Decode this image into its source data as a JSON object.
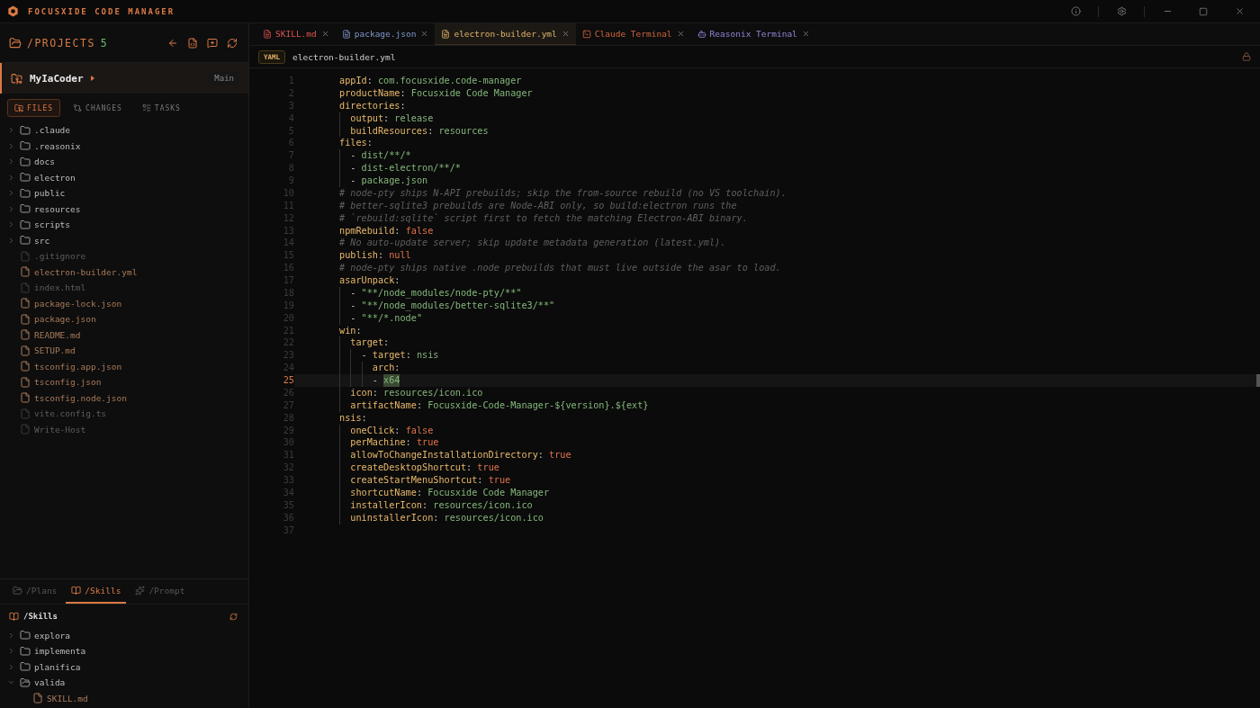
{
  "window": {
    "title": "FOCUSXIDE CODE MANAGER"
  },
  "projects": {
    "label": "/PROJECTS",
    "count": "5"
  },
  "project": {
    "name": "MyIaCoder",
    "branch": "Main",
    "selected": true
  },
  "view_tabs": [
    {
      "label": "FILES",
      "kind": "files",
      "selected": true
    },
    {
      "label": "CHANGES",
      "kind": "changes",
      "selected": false
    },
    {
      "label": "TASKS",
      "kind": "tasks",
      "selected": false
    }
  ],
  "file_tree": [
    {
      "kind": "folder",
      "name": ".claude",
      "expanded": false,
      "dimmed": false
    },
    {
      "kind": "folder",
      "name": ".reasonix",
      "expanded": false,
      "dimmed": false
    },
    {
      "kind": "folder",
      "name": "docs",
      "expanded": false,
      "dimmed": false
    },
    {
      "kind": "folder",
      "name": "electron",
      "expanded": false,
      "dimmed": false
    },
    {
      "kind": "folder",
      "name": "public",
      "expanded": false,
      "dimmed": false
    },
    {
      "kind": "folder",
      "name": "resources",
      "expanded": false,
      "dimmed": false
    },
    {
      "kind": "folder",
      "name": "scripts",
      "expanded": false,
      "dimmed": false
    },
    {
      "kind": "folder",
      "name": "src",
      "expanded": false,
      "dimmed": false
    },
    {
      "kind": "file",
      "name": ".gitignore",
      "dimmed": true
    },
    {
      "kind": "file",
      "name": "electron-builder.yml",
      "dimmed": false
    },
    {
      "kind": "file",
      "name": "index.html",
      "dimmed": true
    },
    {
      "kind": "file",
      "name": "package-lock.json",
      "dimmed": false
    },
    {
      "kind": "file",
      "name": "package.json",
      "dimmed": false
    },
    {
      "kind": "file",
      "name": "README.md",
      "dimmed": false
    },
    {
      "kind": "file",
      "name": "SETUP.md",
      "dimmed": false
    },
    {
      "kind": "file",
      "name": "tsconfig.app.json",
      "dimmed": false
    },
    {
      "kind": "file",
      "name": "tsconfig.json",
      "dimmed": false
    },
    {
      "kind": "file",
      "name": "tsconfig.node.json",
      "dimmed": false
    },
    {
      "kind": "file",
      "name": "vite.config.ts",
      "dimmed": true
    },
    {
      "kind": "file",
      "name": "Write-Host",
      "dimmed": true
    }
  ],
  "bottom_tabs": [
    {
      "label": "/Plans",
      "kind": "plans",
      "selected": false
    },
    {
      "label": "/Skills",
      "kind": "skills",
      "selected": true
    },
    {
      "label": "/Prompt",
      "kind": "prompt",
      "selected": false
    }
  ],
  "skills": {
    "title": "/Skills",
    "tree": [
      {
        "kind": "folder",
        "name": "explora",
        "expanded": false
      },
      {
        "kind": "folder",
        "name": "implementa",
        "expanded": false
      },
      {
        "kind": "folder",
        "name": "planifica",
        "expanded": false
      },
      {
        "kind": "folder",
        "name": "valida",
        "expanded": true,
        "children": [
          {
            "kind": "file",
            "name": "SKILL.md"
          }
        ]
      }
    ]
  },
  "editor_tabs": [
    {
      "label": "SKILL.md",
      "kind": "markdown",
      "selected": false
    },
    {
      "label": "package.json",
      "kind": "json",
      "selected": false
    },
    {
      "label": "electron-builder.yml",
      "kind": "yaml",
      "selected": true
    },
    {
      "label": "Claude Terminal",
      "kind": "terminal",
      "selected": false
    },
    {
      "label": "Reasonix Terminal",
      "kind": "agent",
      "selected": false
    }
  ],
  "file_bar": {
    "badge": "YAML",
    "path": "electron-builder.yml",
    "locked": true
  },
  "code": [
    {
      "number": "1",
      "current": false,
      "tokens": [
        {
          "kind": "key",
          "text": "appId"
        },
        {
          "kind": "punct",
          "text": ": "
        },
        {
          "kind": "value",
          "text": "com.focusxide.code-manager"
        }
      ]
    },
    {
      "number": "2",
      "current": false,
      "tokens": [
        {
          "kind": "key",
          "text": "productName"
        },
        {
          "kind": "punct",
          "text": ": "
        },
        {
          "kind": "value",
          "text": "Focusxide Code Manager"
        }
      ]
    },
    {
      "number": "3",
      "current": false,
      "tokens": [
        {
          "kind": "key",
          "text": "directories"
        },
        {
          "kind": "punct",
          "text": ":"
        }
      ]
    },
    {
      "number": "4",
      "current": false,
      "tokens": [
        {
          "kind": "key",
          "text": "  output"
        },
        {
          "kind": "punct",
          "text": ": "
        },
        {
          "kind": "value",
          "text": "release"
        }
      ]
    },
    {
      "number": "5",
      "current": false,
      "tokens": [
        {
          "kind": "key",
          "text": "  buildResources"
        },
        {
          "kind": "punct",
          "text": ": "
        },
        {
          "kind": "value",
          "text": "resources"
        }
      ]
    },
    {
      "number": "6",
      "current": false,
      "tokens": [
        {
          "kind": "key",
          "text": "files"
        },
        {
          "kind": "punct",
          "text": ":"
        }
      ]
    },
    {
      "number": "7",
      "current": false,
      "tokens": [
        {
          "kind": "punct",
          "text": "  - "
        },
        {
          "kind": "value",
          "text": "dist/**/*"
        }
      ]
    },
    {
      "number": "8",
      "current": false,
      "tokens": [
        {
          "kind": "punct",
          "text": "  - "
        },
        {
          "kind": "value",
          "text": "dist-electron/**/*"
        }
      ]
    },
    {
      "number": "9",
      "current": false,
      "tokens": [
        {
          "kind": "punct",
          "text": "  - "
        },
        {
          "kind": "value",
          "text": "package.json"
        }
      ]
    },
    {
      "number": "10",
      "current": false,
      "tokens": [
        {
          "kind": "comment",
          "text": "# node-pty ships N-API prebuilds; skip the from-source rebuild (no VS toolchain)."
        }
      ]
    },
    {
      "number": "11",
      "current": false,
      "tokens": [
        {
          "kind": "comment",
          "text": "# better-sqlite3 prebuilds are Node-ABI only, so build:electron runs the"
        }
      ]
    },
    {
      "number": "12",
      "current": false,
      "tokens": [
        {
          "kind": "comment",
          "text": "# `rebuild:sqlite` script first to fetch the matching Electron-ABI binary."
        }
      ]
    },
    {
      "number": "13",
      "current": false,
      "tokens": [
        {
          "kind": "key",
          "text": "npmRebuild"
        },
        {
          "kind": "punct",
          "text": ": "
        },
        {
          "kind": "bool",
          "text": "false"
        }
      ]
    },
    {
      "number": "14",
      "current": false,
      "tokens": [
        {
          "kind": "comment",
          "text": "# No auto-update server; skip update metadata generation (latest.yml)."
        }
      ]
    },
    {
      "number": "15",
      "current": false,
      "tokens": [
        {
          "kind": "key",
          "text": "publish"
        },
        {
          "kind": "punct",
          "text": ": "
        },
        {
          "kind": "bool",
          "text": "null"
        }
      ]
    },
    {
      "number": "16",
      "current": false,
      "tokens": [
        {
          "kind": "comment",
          "text": "# node-pty ships native .node prebuilds that must live outside the asar to load."
        }
      ]
    },
    {
      "number": "17",
      "current": false,
      "tokens": [
        {
          "kind": "key",
          "text": "asarUnpack"
        },
        {
          "kind": "punct",
          "text": ":"
        }
      ]
    },
    {
      "number": "18",
      "current": false,
      "tokens": [
        {
          "kind": "punct",
          "text": "  - "
        },
        {
          "kind": "value",
          "text": "\"**/node_modules/node-pty/**\""
        }
      ]
    },
    {
      "number": "19",
      "current": false,
      "tokens": [
        {
          "kind": "punct",
          "text": "  - "
        },
        {
          "kind": "value",
          "text": "\"**/node_modules/better-sqlite3/**\""
        }
      ]
    },
    {
      "number": "20",
      "current": false,
      "tokens": [
        {
          "kind": "punct",
          "text": "  - "
        },
        {
          "kind": "value",
          "text": "\"**/*.node\""
        }
      ]
    },
    {
      "number": "21",
      "current": false,
      "tokens": [
        {
          "kind": "key",
          "text": "win"
        },
        {
          "kind": "punct",
          "text": ":"
        }
      ]
    },
    {
      "number": "22",
      "current": false,
      "tokens": [
        {
          "kind": "key",
          "text": "  target"
        },
        {
          "kind": "punct",
          "text": ":"
        }
      ]
    },
    {
      "number": "23",
      "current": false,
      "tokens": [
        {
          "kind": "punct",
          "text": "    - "
        },
        {
          "kind": "key",
          "text": "target"
        },
        {
          "kind": "punct",
          "text": ": "
        },
        {
          "kind": "value",
          "text": "nsis"
        }
      ]
    },
    {
      "number": "24",
      "current": false,
      "tokens": [
        {
          "kind": "key",
          "text": "      arch"
        },
        {
          "kind": "punct",
          "text": ":"
        }
      ]
    },
    {
      "number": "25",
      "current": true,
      "tokens": [
        {
          "kind": "punct",
          "text": "      - "
        },
        {
          "kind": "selection",
          "text": "x64"
        }
      ]
    },
    {
      "number": "26",
      "current": false,
      "tokens": [
        {
          "kind": "key",
          "text": "  icon"
        },
        {
          "kind": "punct",
          "text": ": "
        },
        {
          "kind": "value",
          "text": "resources/icon.ico"
        }
      ]
    },
    {
      "number": "27",
      "current": false,
      "tokens": [
        {
          "kind": "key",
          "text": "  artifactName"
        },
        {
          "kind": "punct",
          "text": ": "
        },
        {
          "kind": "value",
          "text": "Focusxide-Code-Manager-${version}.${ext}"
        }
      ]
    },
    {
      "number": "28",
      "current": false,
      "tokens": [
        {
          "kind": "key",
          "text": "nsis"
        },
        {
          "kind": "punct",
          "text": ":"
        }
      ]
    },
    {
      "number": "29",
      "current": false,
      "tokens": [
        {
          "kind": "key",
          "text": "  oneClick"
        },
        {
          "kind": "punct",
          "text": ": "
        },
        {
          "kind": "bool",
          "text": "false"
        }
      ]
    },
    {
      "number": "30",
      "current": false,
      "tokens": [
        {
          "kind": "key",
          "text": "  perMachine"
        },
        {
          "kind": "punct",
          "text": ": "
        },
        {
          "kind": "bool",
          "text": "true"
        }
      ]
    },
    {
      "number": "31",
      "current": false,
      "tokens": [
        {
          "kind": "key",
          "text": "  allowToChangeInstallationDirectory"
        },
        {
          "kind": "punct",
          "text": ": "
        },
        {
          "kind": "bool",
          "text": "true"
        }
      ]
    },
    {
      "number": "32",
      "current": false,
      "tokens": [
        {
          "kind": "key",
          "text": "  createDesktopShortcut"
        },
        {
          "kind": "punct",
          "text": ": "
        },
        {
          "kind": "bool",
          "text": "true"
        }
      ]
    },
    {
      "number": "33",
      "current": false,
      "tokens": [
        {
          "kind": "key",
          "text": "  createStartMenuShortcut"
        },
        {
          "kind": "punct",
          "text": ": "
        },
        {
          "kind": "bool",
          "text": "true"
        }
      ]
    },
    {
      "number": "34",
      "current": false,
      "tokens": [
        {
          "kind": "key",
          "text": "  shortcutName"
        },
        {
          "kind": "punct",
          "text": ": "
        },
        {
          "kind": "value",
          "text": "Focusxide Code Manager"
        }
      ]
    },
    {
      "number": "35",
      "current": false,
      "tokens": [
        {
          "kind": "key",
          "text": "  installerIcon"
        },
        {
          "kind": "punct",
          "text": ": "
        },
        {
          "kind": "value",
          "text": "resources/icon.ico"
        }
      ]
    },
    {
      "number": "36",
      "current": false,
      "tokens": [
        {
          "kind": "key",
          "text": "  uninstallerIcon"
        },
        {
          "kind": "punct",
          "text": ": "
        },
        {
          "kind": "value",
          "text": "resources/icon.ico"
        }
      ]
    },
    {
      "number": "37",
      "current": false
    }
  ]
}
